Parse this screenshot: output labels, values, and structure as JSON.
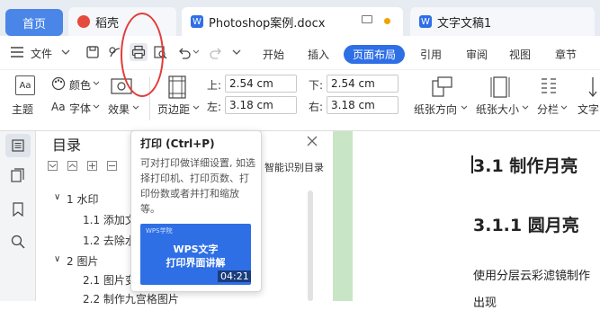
{
  "tabs": {
    "home": "首页",
    "daoke": "稻壳",
    "active_doc": "Photoshop案例.docx",
    "other_doc": "文字文稿1"
  },
  "toolbar": {
    "menu_label": "文件",
    "menu_items": [
      "开始",
      "插入",
      "页面布局",
      "引用",
      "审阅",
      "视图",
      "章节"
    ],
    "active_item": "页面布局"
  },
  "ribbon": {
    "theme": "主题",
    "color": "颜色",
    "font": "字体",
    "effects": "效果",
    "margins": "页边距",
    "top_label": "上:",
    "top_value": "2.54 cm",
    "bottom_label": "下:",
    "bottom_value": "2.54 cm",
    "left_label": "左:",
    "left_value": "3.18 cm",
    "right_label": "右:",
    "right_value": "3.18 cm",
    "orientation": "纸张方向",
    "size": "纸张大小",
    "columns": "分栏",
    "text_direction": "文字"
  },
  "toc": {
    "title": "目录",
    "smart_label": "智能识别目录",
    "items": [
      {
        "label": "1 水印"
      },
      {
        "label": "1.1 添加文"
      },
      {
        "label": "1.2 去除水"
      },
      {
        "label": "2 图片"
      },
      {
        "label": "2.1 图片变"
      },
      {
        "label": "2.2 制作九宫格图片"
      }
    ]
  },
  "tooltip": {
    "title": "打印 (Ctrl+P)",
    "description": "可对打印做详细设置, 如选择打印机、打印页数、打印份数或者并打和缩放等。",
    "video_brand": "WPS学院",
    "video_title_line1": "WPS文字",
    "video_title_line2": "打印界面讲解",
    "video_duration": "04:21"
  },
  "document": {
    "heading1": "3.1 制作月亮",
    "heading2": "3.1.1 圆月亮",
    "body_line1": "使用分层云彩滤镜制作",
    "body_line2": "出现"
  },
  "colors": {
    "accent": "#2f6fe6",
    "annotation": "#e23b3b",
    "doc_background": "#c8e6c6"
  }
}
